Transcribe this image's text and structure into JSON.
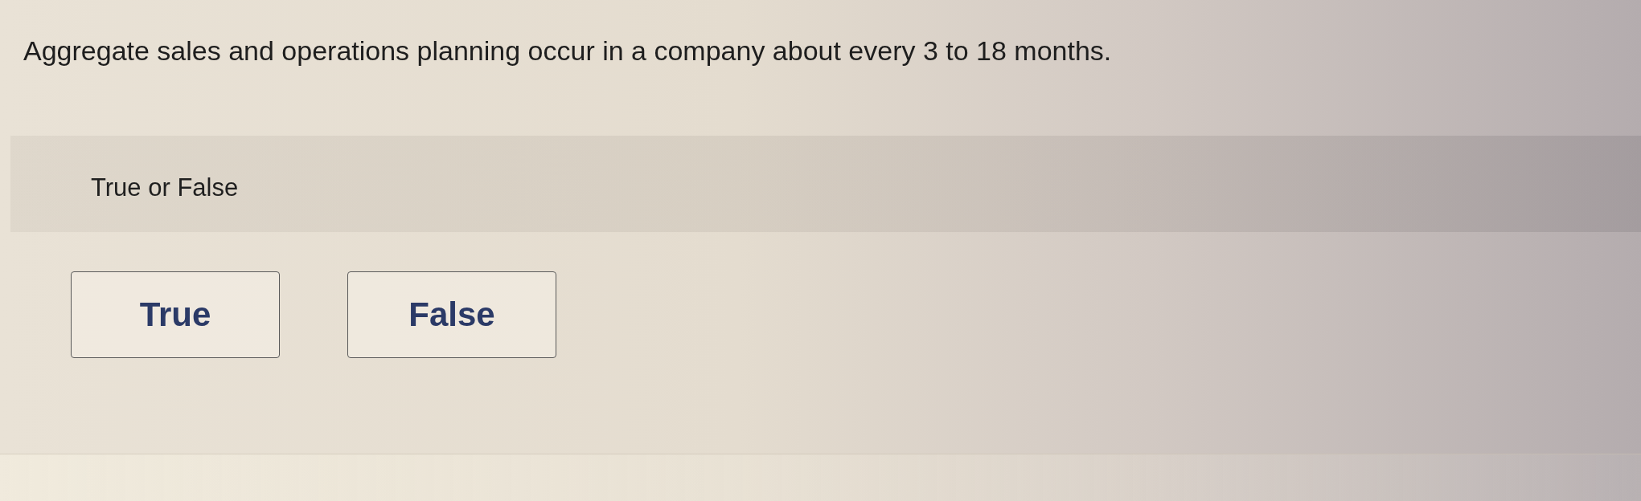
{
  "question": {
    "text": "Aggregate sales and operations planning occur in a company about every 3 to 18 months."
  },
  "answer_panel": {
    "instruction": "True or False"
  },
  "options": [
    {
      "label": "True",
      "selected": false
    },
    {
      "label": "False",
      "selected": false
    }
  ]
}
